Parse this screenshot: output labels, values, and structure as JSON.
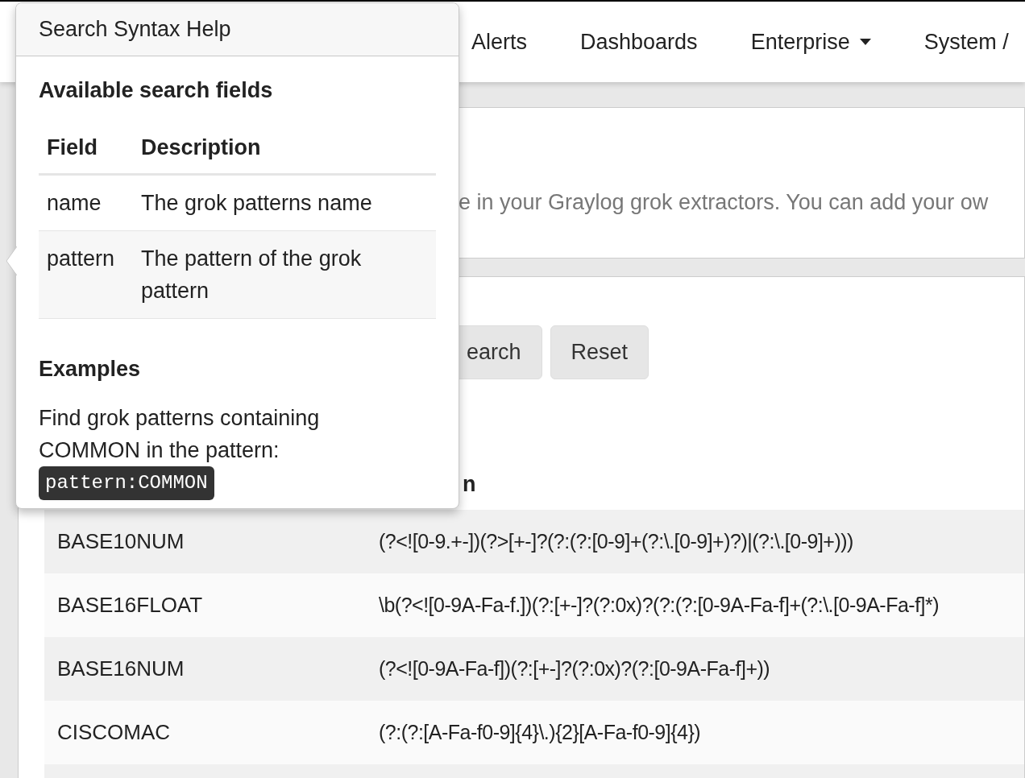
{
  "nav": {
    "items": [
      {
        "label": "Alerts",
        "kind": "link"
      },
      {
        "label": "Dashboards",
        "kind": "link"
      },
      {
        "label": "Enterprise",
        "kind": "dropdown"
      },
      {
        "label": "System /",
        "kind": "link"
      }
    ]
  },
  "description": "e in your Graylog grok extractors. You can add your ow",
  "buttons": [
    "earch",
    "Reset"
  ],
  "table": {
    "column_2_header": "n",
    "rows": [
      {
        "name": "BASE10NUM",
        "pattern": "(?<![0-9.+-])(?>[+-]?(?:(?:[0-9]+(?:\\.[0-9]+)?)|(?:\\.[0-9]+)))"
      },
      {
        "name": "BASE16FLOAT",
        "pattern": "\\b(?<![0-9A-Fa-f.])(?:[+-]?(?:0x)?(?:(?:[0-9A-Fa-f]+(?:\\.[0-9A-Fa-f]*)"
      },
      {
        "name": "BASE16NUM",
        "pattern": "(?<![0-9A-Fa-f])(?:[+-]?(?:0x)?(?:[0-9A-Fa-f]+))"
      },
      {
        "name": "CISCOMAC",
        "pattern": "(?:(?:[A-Fa-f0-9]{4}\\.){2}[A-Fa-f0-9]{4})"
      }
    ]
  },
  "popover": {
    "title": "Search Syntax Help",
    "fields_heading": "Available search fields",
    "columns": [
      "Field",
      "Description"
    ],
    "rows": [
      {
        "field": "name",
        "description": "The grok patterns name"
      },
      {
        "field": "pattern",
        "description": "The pattern of the grok pattern"
      }
    ],
    "examples_heading": "Examples",
    "example_text": "Find grok patterns containing COMMON in the pattern:",
    "example_code": "pattern:COMMON"
  }
}
